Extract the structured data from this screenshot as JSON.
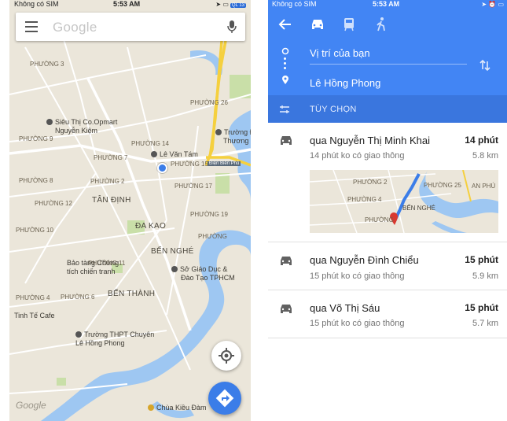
{
  "left": {
    "status": {
      "carrier": "Không có SIM",
      "time": "5:53 AM",
      "badge": "QL 13"
    },
    "search": {
      "placeholder": "Google"
    },
    "labels": {
      "phuong3": "PHƯỜNG 3",
      "phuong9a": "PHƯỜNG 9",
      "phuong14": "PHƯỜNG 14",
      "phuong7": "PHƯỜNG 7",
      "phuong15": "PHƯỜNG 15",
      "phuong17": "PHƯỜNG 17",
      "phuong12": "PHƯỜNG 12",
      "phuong2": "PHƯỜNG 2",
      "phuong8": "PHƯỜNG 8",
      "phuong10": "PHƯỜNG 10",
      "phuong11": "PHƯỜNG 11",
      "phuong19": "PHƯỜNG 19",
      "phuong6": "PHƯỜNG 6",
      "phuong4": "PHƯỜNG 4",
      "phuong26": "PHƯỜNG 26",
      "tandinh": "TÂN ĐỊNH",
      "dakao": "ĐA KAO",
      "bennghe": "BẾN NGHÉ",
      "benthanh": "BẾN THÀNH",
      "ppp": "PHƯỜNG"
    },
    "pois": {
      "coopmart": "Siêu Thị Co.Opmart",
      "coopmart2": "Nguyễn Kiệm",
      "levantam": "Lê Văn Tám",
      "truongdai": "Trường Đại",
      "truongdai2": "Thương -",
      "baotang": "Bảo tàng Chứng",
      "baotang2": "tích chiến tranh",
      "sogiaoduc": "Sở Giáo Dục &",
      "sogiaoduc2": "Đào Tạo TPHCM",
      "tinhte": "Tinh Tế Cafe",
      "lehongphong": "Trường THPT Chuyên",
      "lehongphong2": "Lê Hồng Phong",
      "chuakieudam": "Chùa Kiều Đàm",
      "dienbienphu": "Điện Biên Phủ"
    },
    "watermark": "Google",
    "icons": {
      "menu": "menu-icon",
      "mic": "mic-icon",
      "location": "my-location-icon",
      "directions": "directions-icon"
    }
  },
  "right": {
    "status": {
      "carrier": "Không có SIM",
      "time": "5:53 AM"
    },
    "origin": "Vị trí của bạn",
    "destination": "Lê Hồng Phong",
    "options_label": "TÙY CHỌN",
    "routes": [
      {
        "via": "qua Nguyễn Thị Minh Khai",
        "duration": "14",
        "duration_unit": "phút",
        "traffic": "14 phút ko có giao thông",
        "distance": "5.8 km",
        "mini_labels": {
          "a": "PHƯỜNG 2",
          "b": "PHƯỜNG 25",
          "c": "PHƯỜNG 4",
          "d": "BẾN NGHÉ",
          "e": "PHƯỜNG",
          "f": "AN PHÚ"
        }
      },
      {
        "via": "qua Nguyễn Đình Chiểu",
        "duration": "15",
        "duration_unit": "phút",
        "traffic": "15 phút ko có giao thông",
        "distance": "5.9 km"
      },
      {
        "via": "qua Võ Thị Sáu",
        "duration": "15",
        "duration_unit": "phút",
        "traffic": "15 phút ko có giao thông",
        "distance": "5.7 km"
      }
    ],
    "icons": {
      "back": "back-arrow-icon",
      "car": "car-icon",
      "transit": "transit-icon",
      "walk": "walk-icon",
      "swap": "swap-icon",
      "options": "options-icon"
    }
  },
  "colors": {
    "accent": "#4285f4",
    "options_bar": "#3a76de",
    "map_bg": "#ebe6da",
    "highway": "#f5d03e",
    "water": "#9ec7f2"
  }
}
